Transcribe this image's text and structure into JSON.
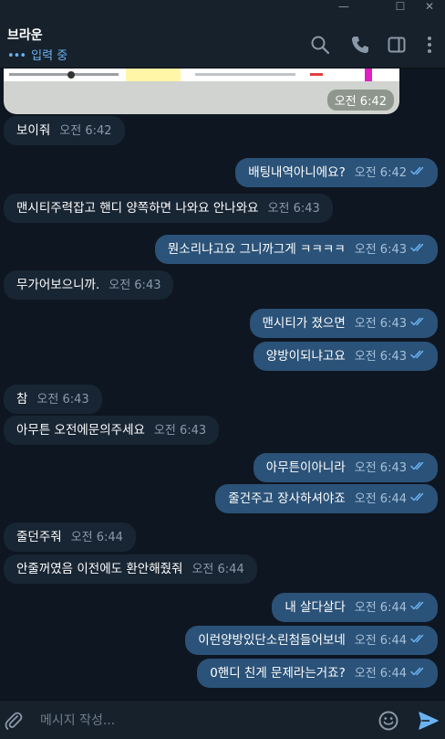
{
  "window": {
    "minimize": "—",
    "maximize": "☐",
    "close": "✕"
  },
  "header": {
    "name": "브라운",
    "status_dots": "•••",
    "status": "입력 중"
  },
  "image_message": {
    "time": "오전 6:42"
  },
  "messages": [
    {
      "dir": "in",
      "text": "보이줘",
      "time": "오전 6:42"
    },
    {
      "dir": "out",
      "text": "배팅내역아니에요?",
      "time": "오전 6:42"
    },
    {
      "dir": "in",
      "text": "맨시티주력잡고 핸디 양쪽하면 나와요 안나와요",
      "time": "오전 6:43"
    },
    {
      "dir": "out",
      "text": "뭔소리냐고요 그니까그게 ㅋㅋㅋㅋ",
      "time": "오전 6:43"
    },
    {
      "dir": "in",
      "text": "무가어보으니까.",
      "time": "오전 6:43"
    },
    {
      "dir": "out",
      "text": "맨시티가 졌으면",
      "time": "오전 6:43"
    },
    {
      "dir": "out",
      "text": "양방이되냐고요",
      "time": "오전 6:43"
    },
    {
      "dir": "in",
      "text": "참",
      "time": "오전 6:43"
    },
    {
      "dir": "in",
      "text": "아무튼 오전에문의주세요",
      "time": "오전 6:43"
    },
    {
      "dir": "out",
      "text": "아무튼이아니라",
      "time": "오전 6:43"
    },
    {
      "dir": "out",
      "text": "줄건주고 장사하셔야죠",
      "time": "오전 6:44"
    },
    {
      "dir": "in",
      "text": "줄던주줘",
      "time": "오전 6:44"
    },
    {
      "dir": "in",
      "text": "안줄꺼였음 이전에도 환안해줬줘",
      "time": "오전 6:44"
    },
    {
      "dir": "out",
      "text": "내 살다살다",
      "time": "오전 6:44"
    },
    {
      "dir": "out",
      "text": "이런양방있단소린첨들어보네",
      "time": "오전 6:44"
    },
    {
      "dir": "out",
      "text": "0핸디 친게 문제라는거죠?",
      "time": "오전 6:44"
    }
  ],
  "composer": {
    "placeholder": "메시지 작성..."
  },
  "colors": {
    "background": "#0e1621",
    "incoming": "#182533",
    "outgoing": "#2b5278",
    "accent": "#6ab3f3"
  },
  "icons": [
    "search-icon",
    "phone-icon",
    "sidebar-icon",
    "more-icon",
    "attach-icon",
    "emoji-icon",
    "send-icon"
  ]
}
